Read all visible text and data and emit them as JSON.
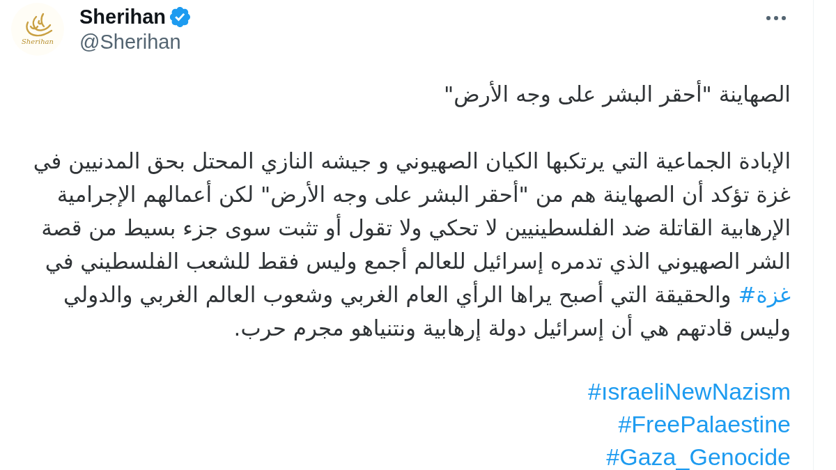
{
  "author": {
    "logo_text": "Sherihan",
    "name": "Sherihan",
    "verified": true,
    "handle": "@Sherihan"
  },
  "tweet": {
    "title": "الصهاينة \"أحقر البشر على وجه الأرض\"",
    "paragraph": [
      {
        "kind": "text",
        "text": "الإبادة الجماعية التي يرتكبها الكيان الصهيوني و جيشه النازي المحتل بحق المدنيين في غزة تؤكد أن الصهاينة هم من \"أحقر البشر على وجه الأرض\" لكن أعمالهم الإجرامية الإرهابية القاتلة ضد الفلسطينيين لا تحكي ولا تقول أو تثبت سوى جزء بسيط من قصة الشر الصهيوني الذي تدمره إسرائيل للعالم أجمع وليس فقط للشعب الفلسطيني في "
      },
      {
        "kind": "hashtag",
        "text": "#غزة"
      },
      {
        "kind": "text",
        "text": " والحقيقة التي أصبح يراها الرأي العام الغربي وشعوب العالم الغربي والدولي وليس قادتهم هي أن إسرائيل دولة إرهابية ونتنياهو مجرم حرب."
      }
    ],
    "hashtags": [
      "#ısraeliNewNazism",
      "#FreePalaestine",
      "#Gaza_Genocide"
    ]
  }
}
